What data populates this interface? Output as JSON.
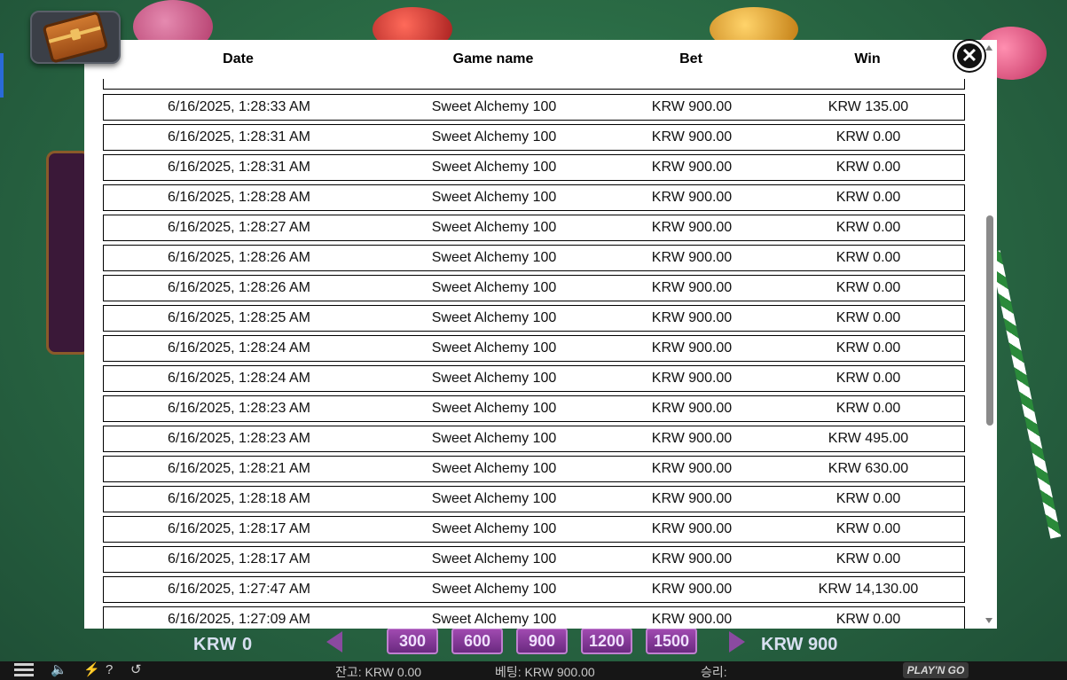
{
  "table": {
    "headers": {
      "date": "Date",
      "game": "Game name",
      "bet": "Bet",
      "win": "Win"
    },
    "rows": [
      {
        "date": "6/16/2025, 1:28:33 AM",
        "game": "Sweet Alchemy 100",
        "bet": "KRW 900.00",
        "win": "KRW 135.00"
      },
      {
        "date": "6/16/2025, 1:28:31 AM",
        "game": "Sweet Alchemy 100",
        "bet": "KRW 900.00",
        "win": "KRW 0.00"
      },
      {
        "date": "6/16/2025, 1:28:31 AM",
        "game": "Sweet Alchemy 100",
        "bet": "KRW 900.00",
        "win": "KRW 0.00"
      },
      {
        "date": "6/16/2025, 1:28:28 AM",
        "game": "Sweet Alchemy 100",
        "bet": "KRW 900.00",
        "win": "KRW 0.00"
      },
      {
        "date": "6/16/2025, 1:28:27 AM",
        "game": "Sweet Alchemy 100",
        "bet": "KRW 900.00",
        "win": "KRW 0.00"
      },
      {
        "date": "6/16/2025, 1:28:26 AM",
        "game": "Sweet Alchemy 100",
        "bet": "KRW 900.00",
        "win": "KRW 0.00"
      },
      {
        "date": "6/16/2025, 1:28:26 AM",
        "game": "Sweet Alchemy 100",
        "bet": "KRW 900.00",
        "win": "KRW 0.00"
      },
      {
        "date": "6/16/2025, 1:28:25 AM",
        "game": "Sweet Alchemy 100",
        "bet": "KRW 900.00",
        "win": "KRW 0.00"
      },
      {
        "date": "6/16/2025, 1:28:24 AM",
        "game": "Sweet Alchemy 100",
        "bet": "KRW 900.00",
        "win": "KRW 0.00"
      },
      {
        "date": "6/16/2025, 1:28:24 AM",
        "game": "Sweet Alchemy 100",
        "bet": "KRW 900.00",
        "win": "KRW 0.00"
      },
      {
        "date": "6/16/2025, 1:28:23 AM",
        "game": "Sweet Alchemy 100",
        "bet": "KRW 900.00",
        "win": "KRW 0.00"
      },
      {
        "date": "6/16/2025, 1:28:23 AM",
        "game": "Sweet Alchemy 100",
        "bet": "KRW 900.00",
        "win": "KRW 495.00"
      },
      {
        "date": "6/16/2025, 1:28:21 AM",
        "game": "Sweet Alchemy 100",
        "bet": "KRW 900.00",
        "win": "KRW 630.00"
      },
      {
        "date": "6/16/2025, 1:28:18 AM",
        "game": "Sweet Alchemy 100",
        "bet": "KRW 900.00",
        "win": "KRW 0.00"
      },
      {
        "date": "6/16/2025, 1:28:17 AM",
        "game": "Sweet Alchemy 100",
        "bet": "KRW 900.00",
        "win": "KRW 0.00"
      },
      {
        "date": "6/16/2025, 1:28:17 AM",
        "game": "Sweet Alchemy 100",
        "bet": "KRW 900.00",
        "win": "KRW 0.00"
      },
      {
        "date": "6/16/2025, 1:27:47 AM",
        "game": "Sweet Alchemy 100",
        "bet": "KRW 900.00",
        "win": "KRW 14,130.00"
      },
      {
        "date": "6/16/2025, 1:27:09 AM",
        "game": "Sweet Alchemy 100",
        "bet": "KRW 900.00",
        "win": "KRW 0.00"
      }
    ]
  },
  "game_bar": {
    "left_amount": "KRW 0",
    "right_amount": "KRW 900",
    "bet_chips": [
      "300",
      "600",
      "900",
      "1200",
      "1500"
    ]
  },
  "status_bar": {
    "balance": "잔고: KRW 0.00",
    "bet": "베팅: KRW 900.00",
    "win": "승리:",
    "logo": "PLAY'N GO"
  },
  "icons": {
    "close": "close-icon",
    "history": "history-icon",
    "chest": "treasure-chest-icon"
  }
}
